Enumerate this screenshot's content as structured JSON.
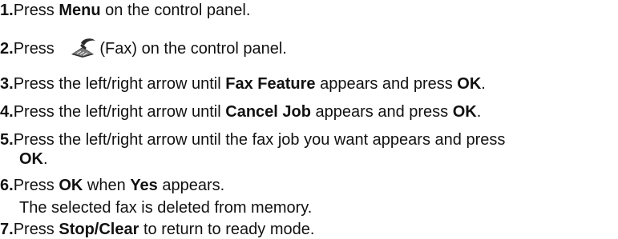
{
  "steps": [
    {
      "num": "1.",
      "pre": "Press ",
      "b1": "Menu",
      "post": " on the control panel."
    },
    {
      "num": "2.",
      "pre": "Press ",
      "icon": "fax-icon",
      "post": "(Fax) on the control panel."
    },
    {
      "num": "3.",
      "pre": "Press the left/right arrow until ",
      "b1": "Fax Feature",
      "mid": " appears and press ",
      "b2": "OK",
      "post": "."
    },
    {
      "num": "4.",
      "pre": "Press the left/right arrow until ",
      "b1": "Cancel Job",
      "mid": " appears and press ",
      "b2": "OK",
      "post": "."
    },
    {
      "num": "5.",
      "pre": "Press the left/right arrow until the fax job you want appears and press",
      "b1": "OK",
      "post": "."
    },
    {
      "num": "6.",
      "pre": "Press ",
      "b1": "OK",
      "mid": " when ",
      "b2": "Yes",
      "post": " appears.",
      "note": "The selected fax is deleted from memory."
    },
    {
      "num": "7.",
      "pre": "Press ",
      "b1": "Stop/Clear",
      "post": " to return to ready mode."
    }
  ]
}
